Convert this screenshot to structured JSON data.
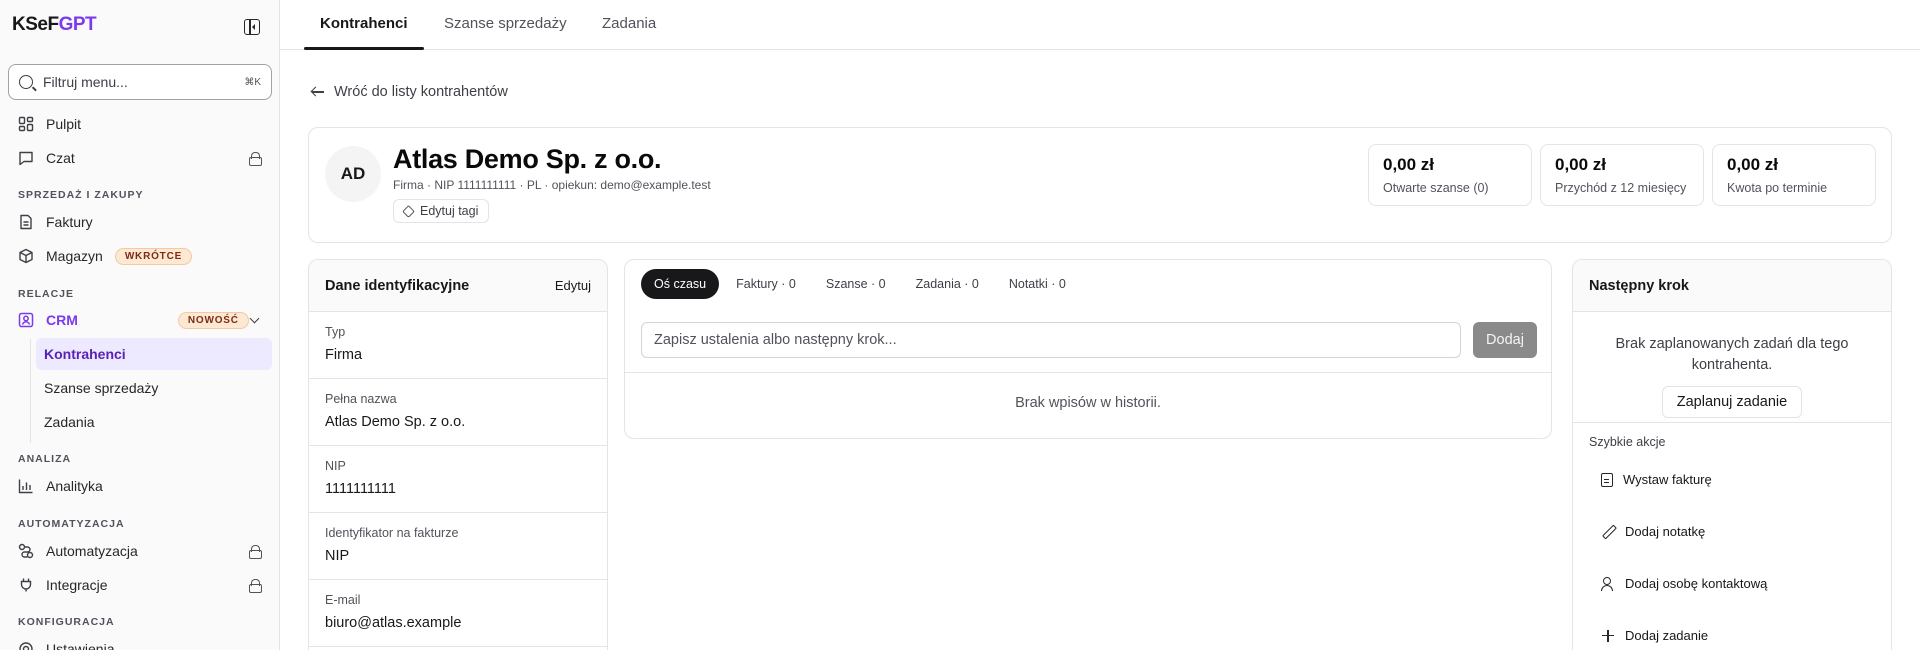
{
  "sidebar": {
    "logo_main": "KSeF",
    "logo_accent": "GPT",
    "filter_placeholder": "Filtruj menu...",
    "filter_shortcut": "⌘K",
    "items": {
      "dashboard": "Pulpit",
      "chat": "Czat",
      "invoices": "Faktury",
      "warehouse": "Magazyn",
      "warehouse_badge": "WKRÓTCE",
      "crm": "CRM",
      "crm_badge": "NOWOŚĆ",
      "contractors": "Kontrahenci",
      "opportunities": "Szanse sprzedaży",
      "tasks": "Zadania",
      "analytics": "Analityka",
      "automation": "Automatyzacja",
      "integrations": "Integracje",
      "settings": "Ustawienia"
    },
    "sections": {
      "sales": "SPRZEDAŻ I ZAKUPY",
      "relations": "RELACJE",
      "analysis": "ANALIZA",
      "automation": "AUTOMATYZACJA",
      "configuration": "KONFIGURACJA"
    }
  },
  "tabs": [
    "Kontrahenci",
    "Szanse sprzedaży",
    "Zadania"
  ],
  "back_link": "Wróć do listy kontrahentów",
  "company": {
    "initials": "AD",
    "name": "Atlas Demo Sp. z o.o.",
    "meta": "Firma · NIP 1111111111 · PL · opiekun: demo@example.test",
    "edit_tags": "Edytuj tagi"
  },
  "stats": [
    {
      "value": "0,00 zł",
      "label": "Otwarte szanse (0)"
    },
    {
      "value": "0,00 zł",
      "label": "Przychód z 12 miesięcy"
    },
    {
      "value": "0,00 zł",
      "label": "Kwota po terminie"
    }
  ],
  "identification": {
    "title": "Dane identyfikacyjne",
    "edit": "Edytuj",
    "fields": [
      {
        "label": "Typ",
        "value": "Firma"
      },
      {
        "label": "Pełna nazwa",
        "value": "Atlas Demo Sp. z o.o."
      },
      {
        "label": "NIP",
        "value": "1111111111"
      },
      {
        "label": "Identyfikator na fakturze",
        "value": "NIP"
      },
      {
        "label": "E-mail",
        "value": "biuro@atlas.example"
      }
    ]
  },
  "timeline": {
    "tabs": [
      "Oś czasu",
      "Faktury · 0",
      "Szanse · 0",
      "Zadania · 0",
      "Notatki · 0"
    ],
    "input_placeholder": "Zapisz ustalenia albo następny krok...",
    "add_button": "Dodaj",
    "empty": "Brak wpisów w historii."
  },
  "next_step": {
    "title": "Następny krok",
    "empty": "Brak zaplanowanych zadań dla tego kontrahenta.",
    "plan_button": "Zaplanuj zadanie",
    "quick_label": "Szybkie akcje",
    "actions": [
      "Wystaw fakturę",
      "Dodaj notatkę",
      "Dodaj osobę kontaktową",
      "Dodaj zadanie"
    ]
  },
  "colors": {
    "accent": "#7c3aed",
    "active_nav_bg": "#ede9fe",
    "badge_bg": "#fde8d4"
  }
}
